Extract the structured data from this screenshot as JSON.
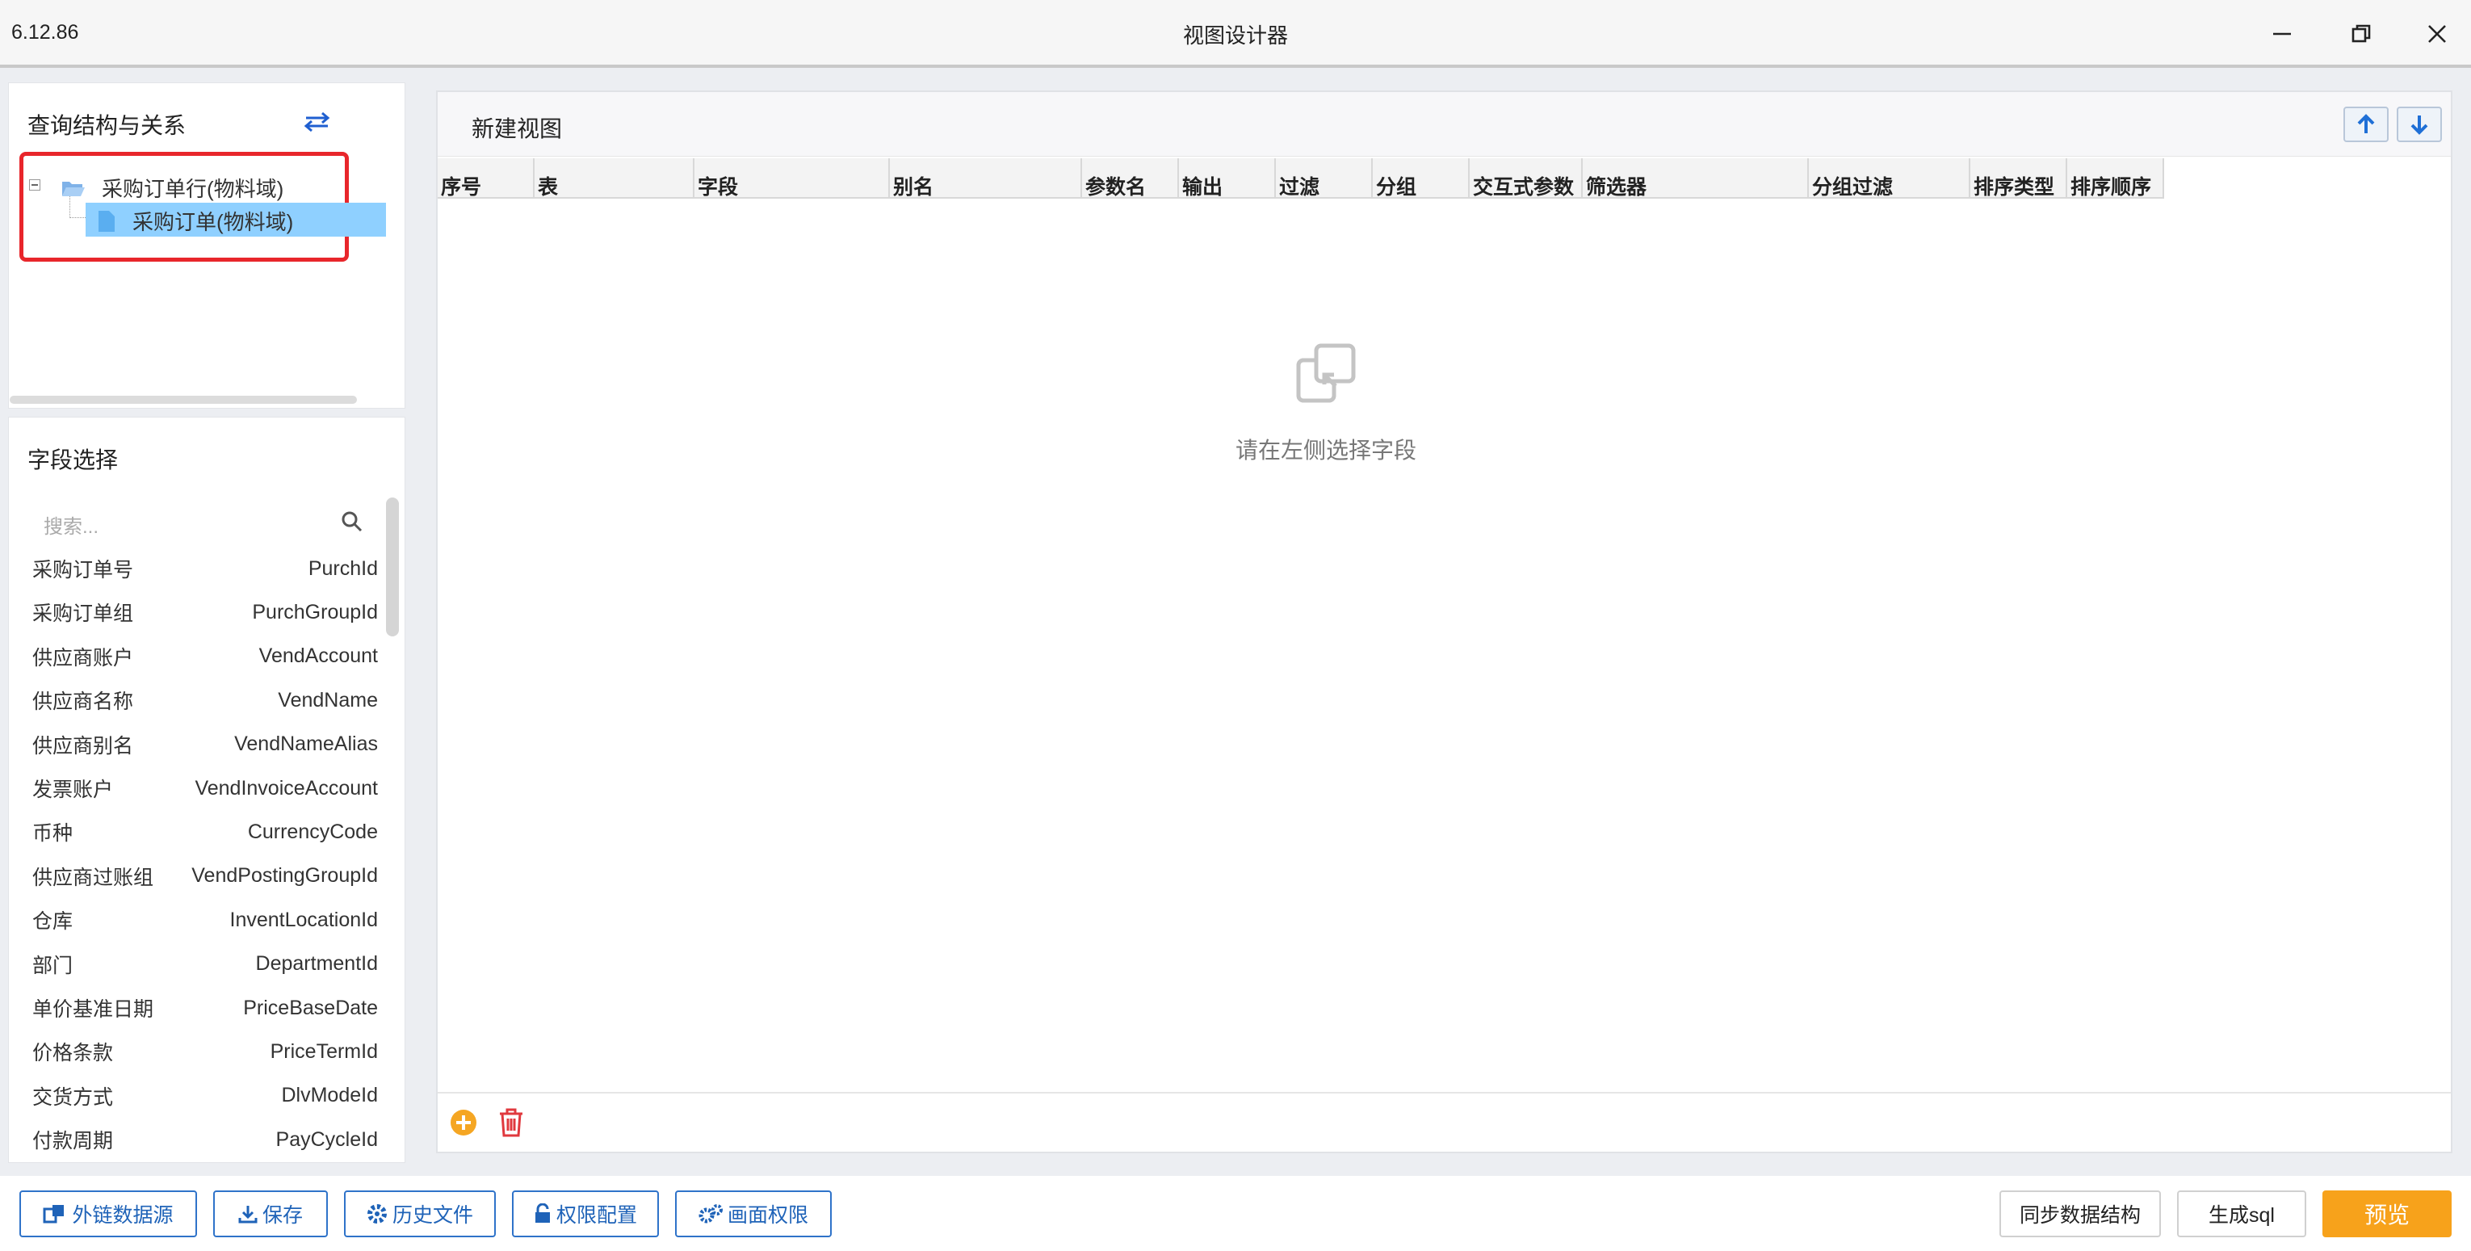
{
  "window": {
    "version": "6.12.86",
    "title": "视图设计器"
  },
  "query_panel": {
    "title": "查询结构与关系",
    "tree": {
      "root": "采购订单行(物料域)",
      "child": "采购订单(物料域)"
    }
  },
  "field_panel": {
    "title": "字段选择",
    "search_placeholder": "搜索...",
    "fields": [
      {
        "label": "采购订单号",
        "code": "PurchId"
      },
      {
        "label": "采购订单组",
        "code": "PurchGroupId"
      },
      {
        "label": "供应商账户",
        "code": "VendAccount"
      },
      {
        "label": "供应商名称",
        "code": "VendName"
      },
      {
        "label": "供应商别名",
        "code": "VendNameAlias"
      },
      {
        "label": "发票账户",
        "code": "VendInvoiceAccount"
      },
      {
        "label": "币种",
        "code": "CurrencyCode"
      },
      {
        "label": "供应商过账组",
        "code": "VendPostingGroupId"
      },
      {
        "label": "仓库",
        "code": "InventLocationId"
      },
      {
        "label": "部门",
        "code": "DepartmentId"
      },
      {
        "label": "单价基准日期",
        "code": "PriceBaseDate"
      },
      {
        "label": "价格条款",
        "code": "PriceTermId"
      },
      {
        "label": "交货方式",
        "code": "DlvModeId"
      },
      {
        "label": "付款周期",
        "code": "PayCycleId"
      }
    ]
  },
  "view": {
    "title": "新建视图",
    "columns": [
      "序号",
      "表",
      "字段",
      "别名",
      "参数名",
      "输出",
      "过滤",
      "分组",
      "交互式参数",
      "筛选器",
      "分组过滤",
      "排序类型",
      "排序顺序"
    ],
    "empty_text": "请在左侧选择字段"
  },
  "bottom": {
    "external_source": "外链数据源",
    "save": "保存",
    "history": "历史文件",
    "permission_config": "权限配置",
    "screen_permission": "画面权限",
    "sync_structure": "同步数据结构",
    "generate_sql": "生成sql",
    "preview": "预览"
  },
  "colors": {
    "accent_blue": "#2f73c9",
    "preview_orange": "#f7a21b",
    "tree_selection": "#8fd0ff",
    "highlight_red": "#e8262b",
    "add_icon_orange": "#f5a623",
    "delete_icon_red": "#e0393e"
  }
}
